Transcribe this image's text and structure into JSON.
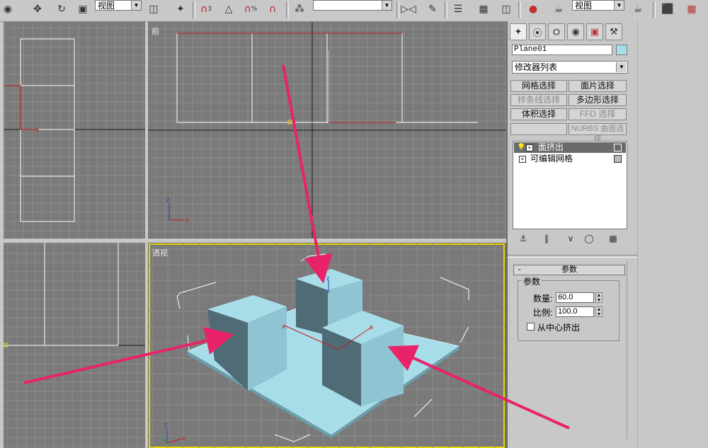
{
  "toolbar": {
    "view_dropdown_1": "视图",
    "view_dropdown_2": "视图",
    "snap_labels": [
      "3",
      "%"
    ]
  },
  "viewports": {
    "front_label": "前",
    "perspective_label": "透视"
  },
  "command_panel": {
    "object_name": "Plane01",
    "object_color": "#a6dde8",
    "modifier_list": "修改器列表",
    "buttons": [
      {
        "label": "网格选择",
        "enabled": true
      },
      {
        "label": "面片选择",
        "enabled": true
      },
      {
        "label": "样条线选择",
        "enabled": false
      },
      {
        "label": "多边形选择",
        "enabled": true
      },
      {
        "label": "体积选择",
        "enabled": true
      },
      {
        "label": "FFD 选择",
        "enabled": false
      },
      {
        "label": "",
        "enabled": false
      },
      {
        "label": "NURBS 曲面选择",
        "enabled": false
      }
    ],
    "stack": [
      "面挤出",
      "可编辑网格"
    ],
    "rollout_title": "参数",
    "group_title": "参数",
    "amount_label": "数量:",
    "amount_value": "60.0",
    "scale_label": "比例:",
    "scale_value": "100.0",
    "from_center_label": "从中心挤出",
    "from_center_checked": false
  },
  "colors": {
    "viewport_bg": "#7a7a7a",
    "active_border": "#e8d800",
    "mesh_light": "#a6dde8",
    "mesh_mid": "#8fc4d2",
    "mesh_dark": "#54727d",
    "arrow": "#e8236a",
    "grid": "#8c8c8c",
    "grid_major": "#1a1a1a"
  }
}
